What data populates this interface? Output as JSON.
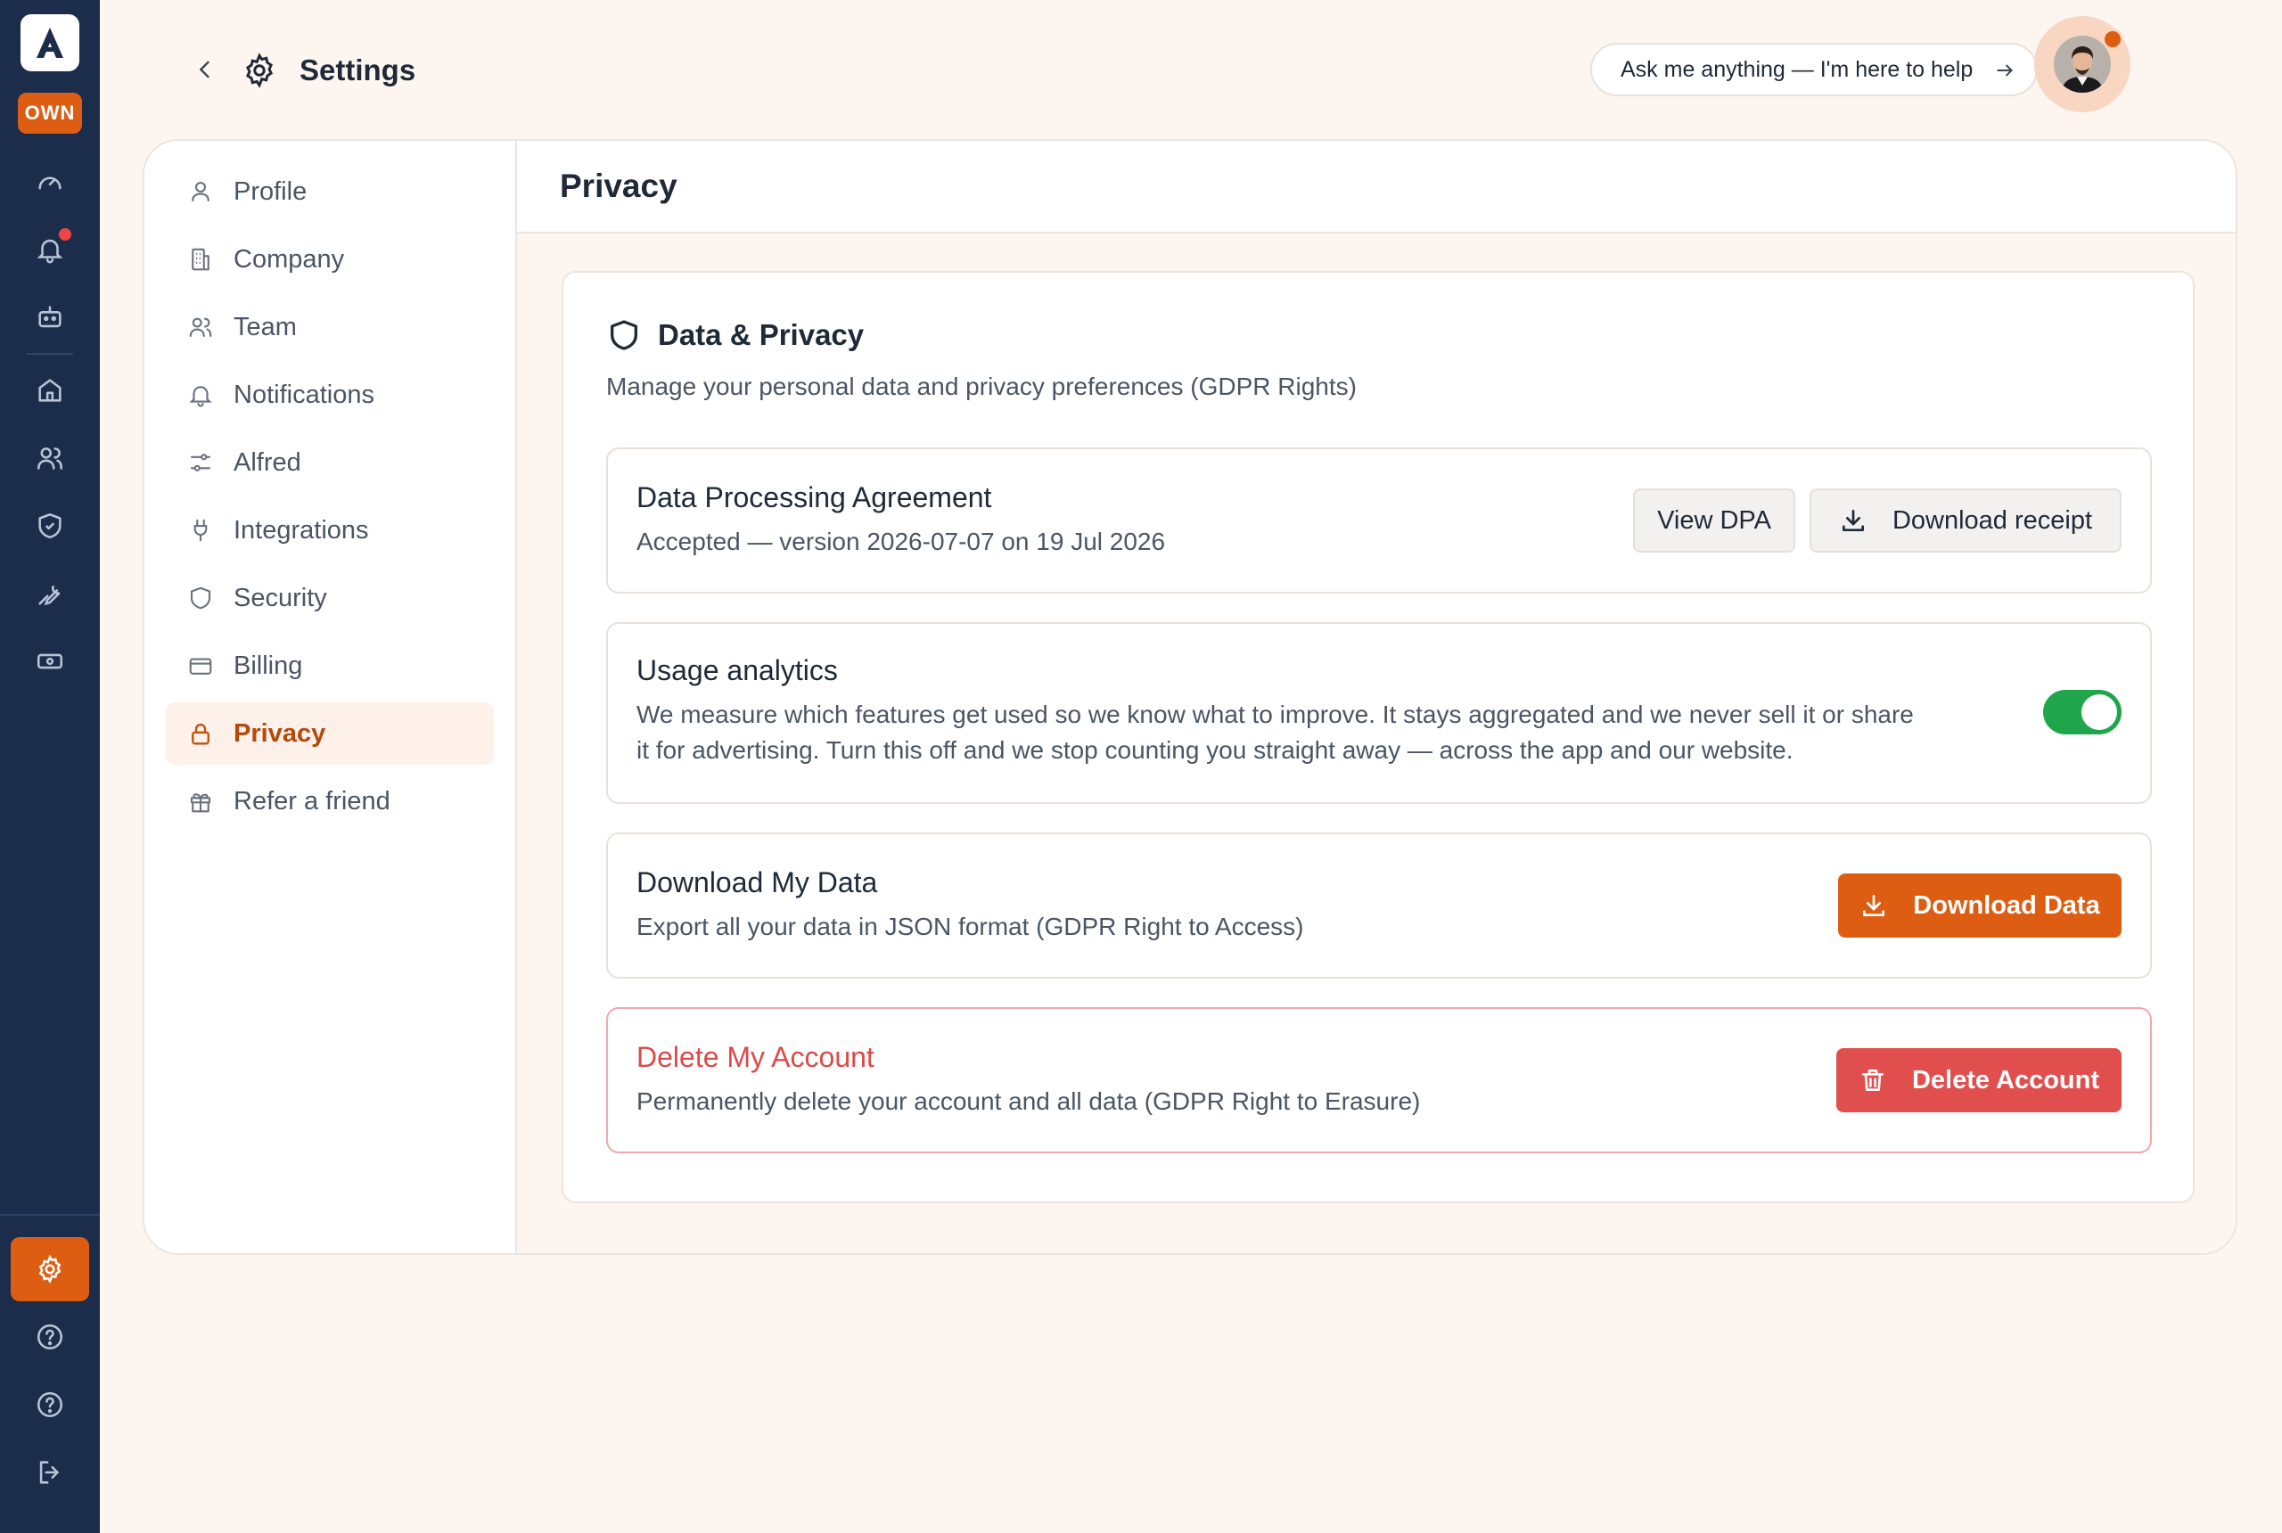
{
  "rail": {
    "badge": "OWN",
    "logo_letter": "A",
    "icons": [
      "gauge-icon",
      "bell-icon",
      "bot-icon",
      "home-icon",
      "users-icon",
      "shield-icon",
      "wrench-icon",
      "cash-icon",
      "gear-icon",
      "help-icon",
      "help-icon",
      "logout-icon"
    ]
  },
  "header": {
    "title": "Settings",
    "ask_text": "Ask me anything — I'm here to help"
  },
  "nav": {
    "items": [
      {
        "label": "Profile",
        "icon": "user-icon"
      },
      {
        "label": "Company",
        "icon": "building-icon"
      },
      {
        "label": "Team",
        "icon": "users-icon"
      },
      {
        "label": "Notifications",
        "icon": "bell-icon"
      },
      {
        "label": "Alfred",
        "icon": "sliders-icon"
      },
      {
        "label": "Integrations",
        "icon": "plug-icon"
      },
      {
        "label": "Security",
        "icon": "shield-icon"
      },
      {
        "label": "Billing",
        "icon": "card-icon"
      },
      {
        "label": "Privacy",
        "icon": "lock-icon",
        "active": true
      },
      {
        "label": "Refer a friend",
        "icon": "gift-icon"
      }
    ]
  },
  "content": {
    "title": "Privacy",
    "section_title": "Data & Privacy",
    "section_subtitle": "Manage your personal data and privacy preferences (GDPR Rights)",
    "dpa": {
      "title": "Data Processing Agreement",
      "desc": "Accepted — version 2026-07-07 on 19 Jul 2026",
      "view_label": "View DPA",
      "download_label": "Download receipt"
    },
    "analytics": {
      "title": "Usage analytics",
      "desc_line1": "We measure which features get used so we know what to improve. It stays aggregated and we never sell it or share",
      "desc_line2": "it for advertising. Turn this off and we stop counting you straight away — across the app and our website.",
      "enabled": true
    },
    "download": {
      "title": "Download My Data",
      "desc": "Export all your data in JSON format (GDPR Right to Access)",
      "button_label": "Download Data"
    },
    "delete": {
      "title": "Delete My Account",
      "desc": "Permanently delete your account and all data (GDPR Right to Erasure)",
      "button_label": "Delete Account"
    }
  },
  "colors": {
    "rail": "#1c2d4b",
    "accent": "#dd5e13",
    "danger": "#e04e4e",
    "toggle_on": "#1fa64a",
    "page_bg": "#fdf5f0"
  }
}
